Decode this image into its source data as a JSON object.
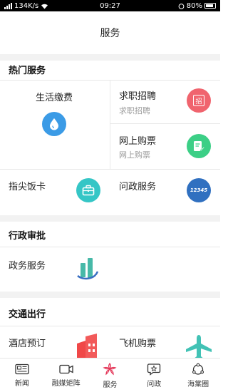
{
  "status_bar": {
    "network_speed": "134K/s",
    "time": "09:27",
    "battery": "80%"
  },
  "header": {
    "title": "服务"
  },
  "sections": {
    "hot": {
      "title": "热门服务",
      "items": {
        "life_pay": {
          "label": "生活缴费"
        },
        "job": {
          "label": "求职招聘",
          "sub": "求职招聘",
          "icon_glyph": "招"
        },
        "ticket": {
          "label": "网上购票",
          "sub": "网上购票"
        },
        "food": {
          "label": "指尖饭卡"
        },
        "gov_ask": {
          "label": "问政服务",
          "icon_glyph": "12345"
        }
      }
    },
    "admin": {
      "title": "行政审批",
      "items": {
        "gov_service": {
          "label": "政务服务"
        }
      }
    },
    "traffic": {
      "title": "交通出行",
      "items": {
        "hotel": {
          "label": "酒店预订"
        },
        "flight": {
          "label": "飞机购票"
        }
      }
    }
  },
  "tabbar": {
    "items": [
      {
        "label": "新闻",
        "icon": "news-icon"
      },
      {
        "label": "融媒矩阵",
        "icon": "video-icon"
      },
      {
        "label": "服务",
        "icon": "flower-icon",
        "active": true
      },
      {
        "label": "问政",
        "icon": "chat-star-icon"
      },
      {
        "label": "海棠圈",
        "icon": "circle-dots-icon"
      }
    ]
  },
  "colors": {
    "accent": "#e4395a",
    "blue": "#3b9be6",
    "red": "#f0646e",
    "green": "#3ccf86",
    "teal": "#35c6c6",
    "navy": "#3070c0",
    "flight": "#42c2b5",
    "hotel": "#f04848"
  }
}
